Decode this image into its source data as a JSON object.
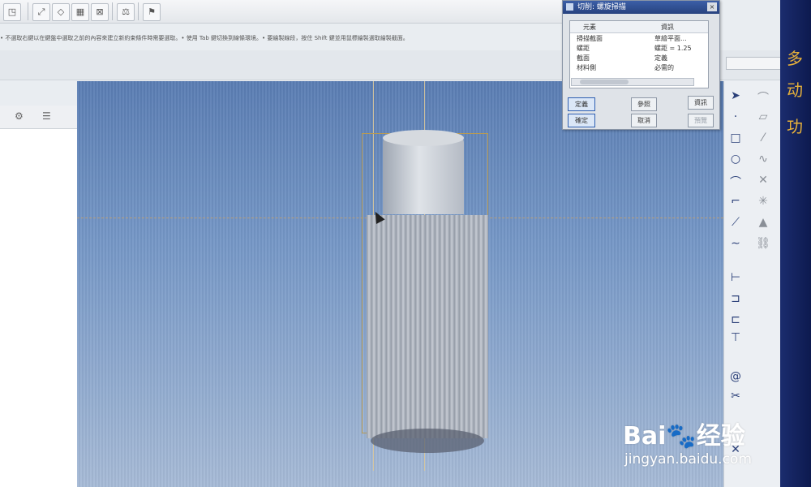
{
  "toolbar": {
    "icons": [
      "sketch-view-icon",
      "constraint-icon",
      "dimension-icon",
      "palette-icon",
      "flag-icon"
    ]
  },
  "message": {
    "text": "• 不選取右鍵以在鍵盤中選取之前的內容來建立新約束條件時需要選取。• 使用 Tab 鍵切換到線條環境。• 要繪製線段，按住 Shift 鍵並用鼠標繪製選取繪製截面。"
  },
  "dialog": {
    "title": "切削: 螺旋掃描",
    "close_glyph": "×",
    "columns": [
      "元素",
      "資訊"
    ],
    "rows": [
      {
        "element": "掃描截面",
        "info": "草繪平面..."
      },
      {
        "element": "螺距",
        "info": "螺距 = 1.25"
      },
      {
        "element": "截面",
        "info": "定義"
      },
      {
        "element": "材料側",
        "info": "必需的"
      }
    ],
    "buttons": {
      "define": "定義",
      "refs": "參照",
      "info": "資訊",
      "ok": "確定",
      "cancel": "取消",
      "preview": "預覽"
    }
  },
  "right_edge_glyphs": [
    "多",
    "功",
    "动"
  ],
  "watermark": {
    "logo": "Bai🐾经验",
    "url": "jingyan.baidu.com"
  }
}
